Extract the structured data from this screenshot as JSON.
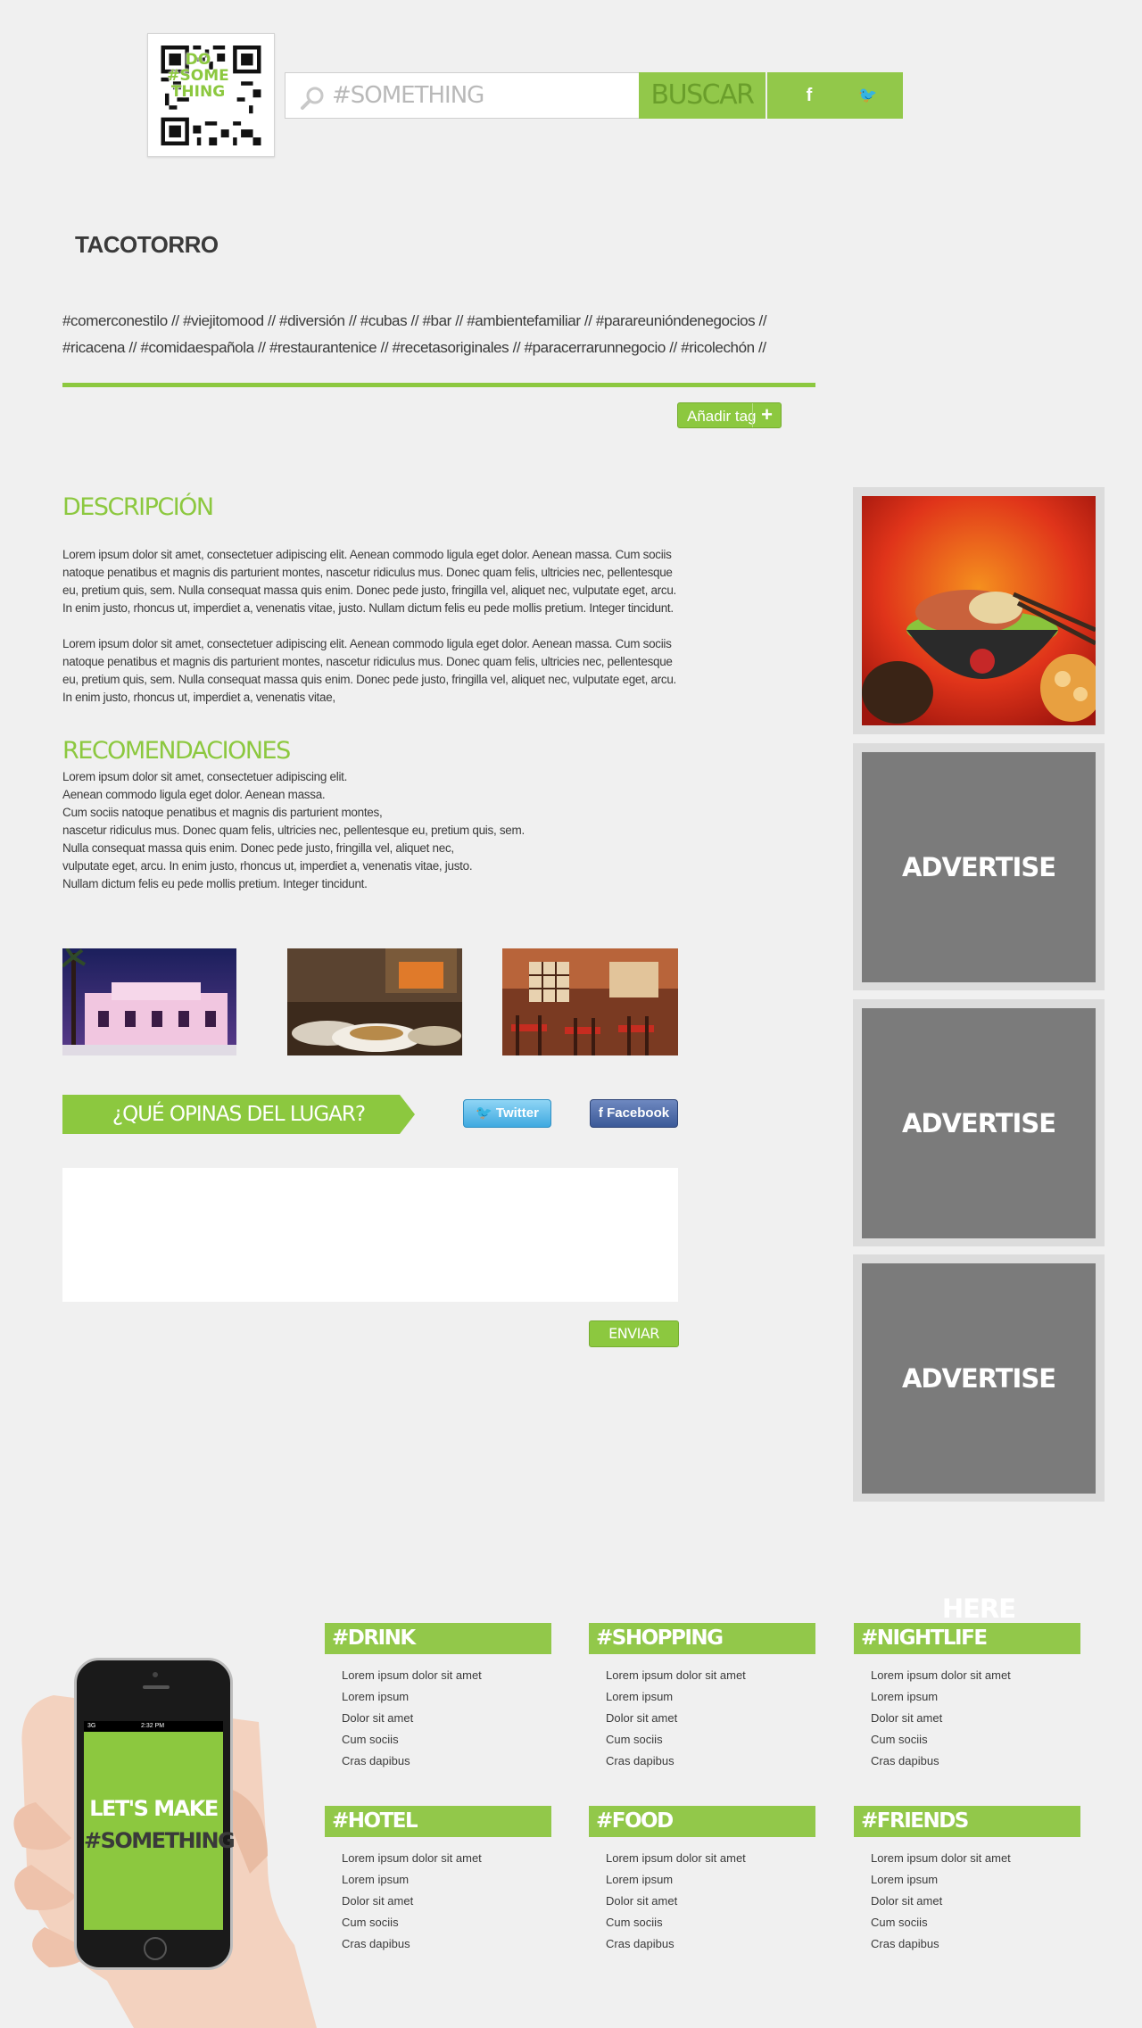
{
  "header": {
    "qr_label": "DO #SOME THING",
    "search_placeholder": "#SOMETHING",
    "search_button": "BUSCAR",
    "facebook_glyph": "f",
    "twitter_glyph": "🐦"
  },
  "place": {
    "name": "TACOTORRO",
    "tags": "#comerconestilo // #viejitomood // #diversión // #cubas //  #bar // #ambientefamiliar // #parareunióndenegocios // #ricacena // #comidaespañola // #restaurantenice // #recetasoriginales // #paracerrarunnegocio // #ricolechón //",
    "add_tag_label": "Añadir tag",
    "add_tag_icon": "+"
  },
  "description": {
    "heading": "DESCRIPCIÓN",
    "paragraphs": [
      "Lorem ipsum dolor sit amet, consectetuer adipiscing elit. Aenean commodo ligula eget dolor. Aenean massa. Cum sociis natoque penatibus et magnis dis parturient montes, nascetur ridiculus mus. Donec quam felis, ultricies nec, pellentesque eu, pretium quis, sem. Nulla consequat massa quis enim. Donec pede justo, fringilla vel, aliquet nec, vulputate eget, arcu. In enim justo, rhoncus ut, imperdiet a, venenatis vitae, justo. Nullam dictum felis eu pede mollis pretium. Integer tincidunt.",
      "Lorem ipsum dolor sit amet, consectetuer adipiscing elit. Aenean commodo ligula eget dolor. Aenean massa. Cum sociis natoque penatibus et magnis dis parturient montes, nascetur ridiculus mus. Donec quam felis, ultricies nec, pellentesque eu, pretium quis, sem. Nulla consequat massa quis enim. Donec pede justo, fringilla vel, aliquet nec, vulputate eget, arcu. In enim justo, rhoncus ut, imperdiet a, venenatis vitae,"
    ]
  },
  "recommendations": {
    "heading": "RECOMENDACIONES",
    "lines": [
      "Lorem ipsum dolor sit amet, consectetuer adipiscing elit.",
      "Aenean commodo ligula eget dolor. Aenean massa.",
      "Cum sociis natoque penatibus et magnis dis parturient montes,",
      "nascetur ridiculus mus. Donec quam felis, ultricies nec, pellentesque eu, pretium quis, sem.",
      "Nulla consequat massa quis enim. Donec pede justo, fringilla vel, aliquet nec,",
      "vulputate eget, arcu. In enim justo, rhoncus ut, imperdiet a, venenatis vitae, justo.",
      "Nullam dictum felis eu pede mollis pretium. Integer tincidunt."
    ]
  },
  "opinion": {
    "banner": "¿QUÉ OPINAS DEL LUGAR?",
    "twitter_label": "Twitter",
    "facebook_label": "Facebook",
    "submit_label": "ENVIAR"
  },
  "sidebar": {
    "ads": [
      "ADVERTISE HERE",
      "ADVERTISE HERE",
      "ADVERTISE HERE"
    ]
  },
  "phone": {
    "carrier": "3G",
    "time": "2:32 PM",
    "line1": "LET'S MAKE",
    "line2": "#SOMETHING"
  },
  "categories": [
    {
      "title": "#DRINK",
      "items": [
        "Lorem ipsum dolor sit amet",
        "Lorem ipsum",
        "Dolor sit amet",
        "Cum sociis",
        "Cras dapibus"
      ]
    },
    {
      "title": "#SHOPPING",
      "items": [
        "Lorem ipsum dolor sit amet",
        "Lorem ipsum",
        "Dolor sit amet",
        "Cum sociis",
        "Cras dapibus"
      ]
    },
    {
      "title": "#NIGHTLIFE",
      "items": [
        "Lorem ipsum dolor sit amet",
        "Lorem ipsum",
        "Dolor sit amet",
        "Cum sociis",
        "Cras dapibus"
      ]
    },
    {
      "title": "#HOTEL",
      "items": [
        "Lorem ipsum dolor sit amet",
        "Lorem ipsum",
        "Dolor sit amet",
        "Cum sociis",
        "Cras dapibus"
      ]
    },
    {
      "title": "#FOOD",
      "items": [
        "Lorem ipsum dolor sit amet",
        "Lorem ipsum",
        "Dolor sit amet",
        "Cum sociis",
        "Cras dapibus"
      ]
    },
    {
      "title": "#FRIENDS",
      "items": [
        "Lorem ipsum dolor sit amet",
        "Lorem ipsum",
        "Dolor sit amet",
        "Cum sociis",
        "Cras dapibus"
      ]
    }
  ],
  "colors": {
    "accent": "#8cc83f",
    "background": "#f0f0f0",
    "ad_gray": "#7b7b7b"
  }
}
